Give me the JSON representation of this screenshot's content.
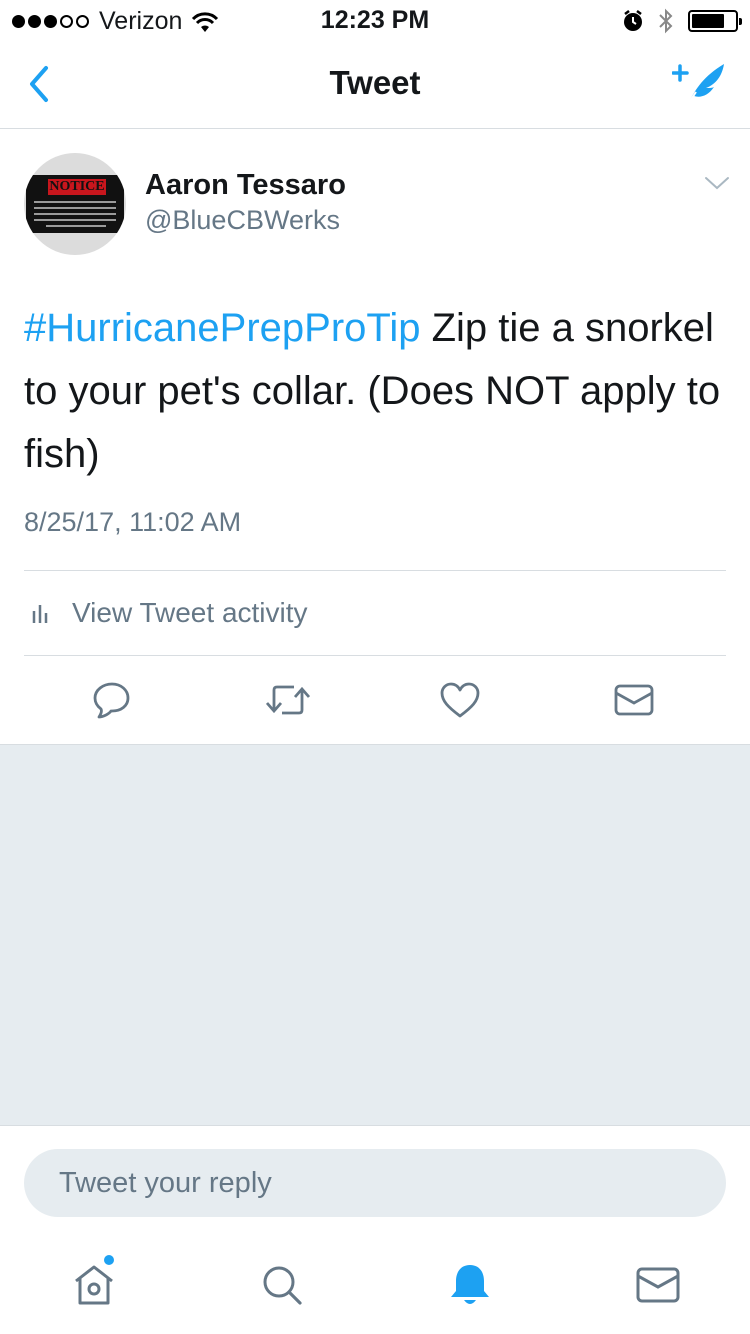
{
  "status_bar": {
    "carrier": "Verizon",
    "time": "12:23 PM",
    "signal_bars_filled": 3,
    "signal_bars_total": 5,
    "battery_level": 0.75
  },
  "nav": {
    "title": "Tweet",
    "back_icon": "chevron-left-icon",
    "compose_icon": "compose-tweet-icon"
  },
  "tweet": {
    "author_name": "Aaron Tessaro",
    "author_handle": "@BlueCBWerks",
    "avatar_sign_title": "NOTICE",
    "avatar_sign_text": "We reserve the right to refuse service to assholes. If you are deemed an asshole you will be removed from the premises and we will talk shit about you on Facebook.",
    "hashtag": "#HurricanePrepProTip",
    "text": " Zip tie a snorkel to your pet's collar. (Does NOT apply to fish)",
    "timestamp": "8/25/17, 11:02 AM",
    "activity_label": "View Tweet activity"
  },
  "actions": [
    "reply-icon",
    "retweet-icon",
    "like-icon",
    "direct-message-icon"
  ],
  "reply": {
    "placeholder": "Tweet your reply"
  },
  "tabs": [
    "home-icon",
    "search-icon",
    "notifications-icon",
    "messages-icon"
  ],
  "colors": {
    "accent": "#1da1f2",
    "text": "#14171a",
    "secondary_text": "#657786",
    "divider": "#d8dde1",
    "background_gray": "#e6ecf0"
  }
}
